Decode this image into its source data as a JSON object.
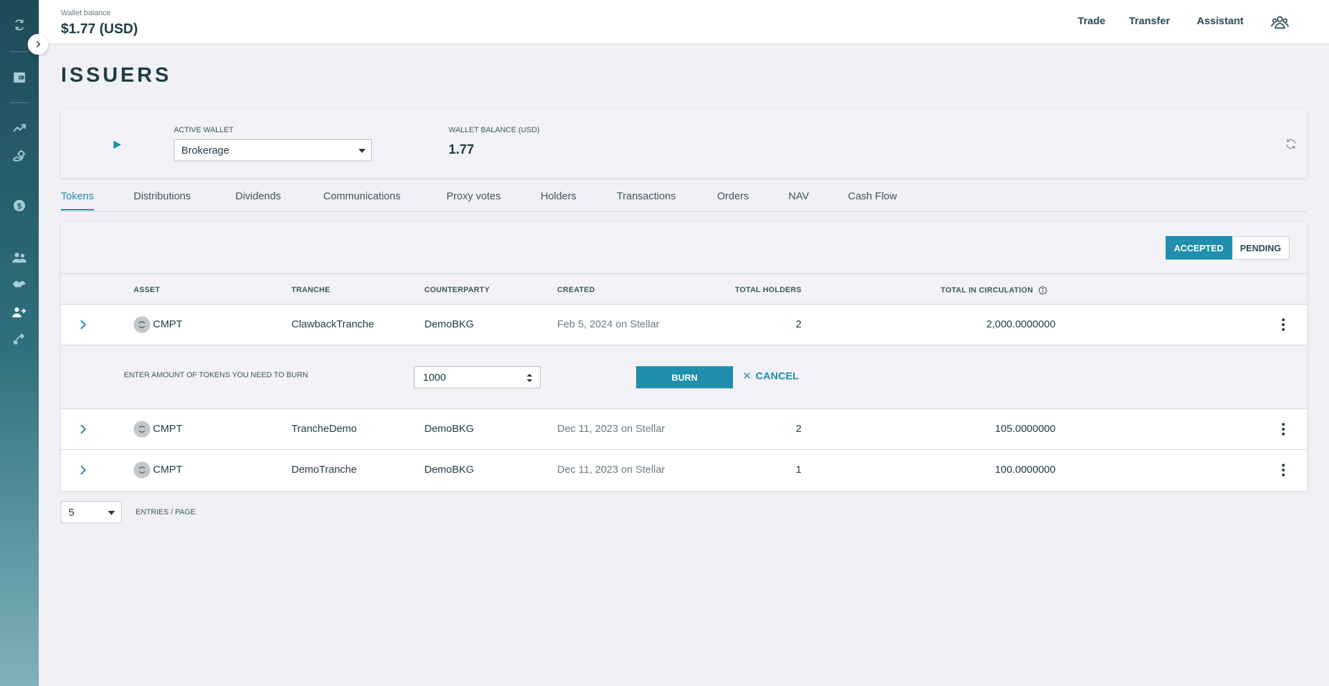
{
  "header": {
    "wallet_balance_label": "Wallet balance",
    "wallet_balance_value": "$1.77 (USD)",
    "nav": {
      "trade": "Trade",
      "transfer": "Transfer",
      "assistant": "Assistant"
    }
  },
  "page": {
    "title": "ISSUERS"
  },
  "wallet_card": {
    "active_wallet_label": "ACTIVE WALLET",
    "active_wallet_value": "Brokerage",
    "balance_label": "WALLET BALANCE (USD)",
    "balance_value": "1.77"
  },
  "tabs": [
    {
      "label": "Tokens",
      "active": true
    },
    {
      "label": "Distributions"
    },
    {
      "label": "Dividends"
    },
    {
      "label": "Communications"
    },
    {
      "label": "Proxy votes"
    },
    {
      "label": "Holders"
    },
    {
      "label": "Transactions"
    },
    {
      "label": "Orders"
    },
    {
      "label": "NAV"
    },
    {
      "label": "Cash Flow"
    }
  ],
  "status_toggle": {
    "accepted": "ACCEPTED",
    "pending": "PENDING",
    "selected": "ACCEPTED"
  },
  "table": {
    "columns": {
      "asset": "ASSET",
      "tranche": "TRANCHE",
      "counterparty": "COUNTERPARTY",
      "created": "CREATED",
      "total_holders": "TOTAL HOLDERS",
      "total_in_circulation": "TOTAL IN CIRCULATION"
    },
    "rows": [
      {
        "asset": "CMPT",
        "tranche": "ClawbackTranche",
        "counterparty": "DemoBKG",
        "created": "Feb 5, 2024 on Stellar",
        "total_holders": "2",
        "total_in_circulation": "2,000.0000000"
      },
      {
        "asset": "CMPT",
        "tranche": "TrancheDemo",
        "counterparty": "DemoBKG",
        "created": "Dec 11, 2023 on Stellar",
        "total_holders": "2",
        "total_in_circulation": "105.0000000"
      },
      {
        "asset": "CMPT",
        "tranche": "DemoTranche",
        "counterparty": "DemoBKG",
        "created": "Dec 11, 2023 on Stellar",
        "total_holders": "1",
        "total_in_circulation": "100.0000000"
      }
    ],
    "burn_panel": {
      "label": "ENTER AMOUNT OF TOKENS YOU NEED TO BURN",
      "amount_value": "1000",
      "burn_button": "BURN",
      "cancel_button": "CANCEL"
    }
  },
  "pagination": {
    "page_size": "5",
    "entries_label": "ENTRIES / PAGE"
  },
  "colors": {
    "accent": "#1f8fad",
    "sidebar_top": "#1e4a58",
    "sidebar_bottom": "#7fb2bb",
    "text": "#1d3b45"
  }
}
